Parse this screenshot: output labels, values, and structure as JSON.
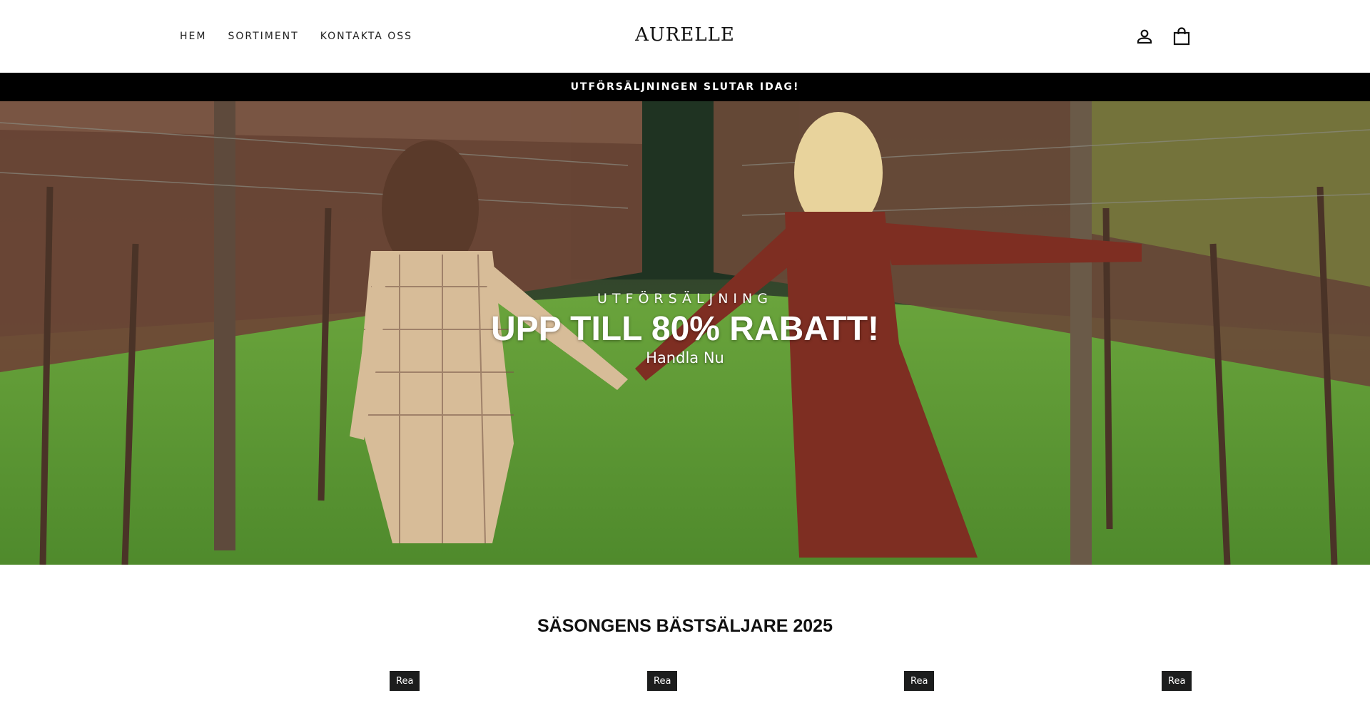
{
  "header": {
    "nav": [
      "HEM",
      "SORTIMENT",
      "KONTAKTA OSS"
    ],
    "logo": "AURELLE",
    "icons": {
      "account": "person-icon",
      "cart": "shopping-bag-icon"
    }
  },
  "announcement": "UTFÖRSÄLJNINGEN SLUTAR IDAG!",
  "hero": {
    "subtitle": "UTFÖRSÄLJNING",
    "title": "UPP TILL 80% RABATT!",
    "cta": "Handla Nu"
  },
  "bestsellers": {
    "title": "SÄSONGENS BÄSTSÄLJARE 2025",
    "badges": [
      "Rea",
      "Rea",
      "Rea",
      "Rea"
    ]
  },
  "colors": {
    "announcement_bg": "#000000",
    "badge_bg": "#1c1d1d",
    "text": "#111111"
  }
}
